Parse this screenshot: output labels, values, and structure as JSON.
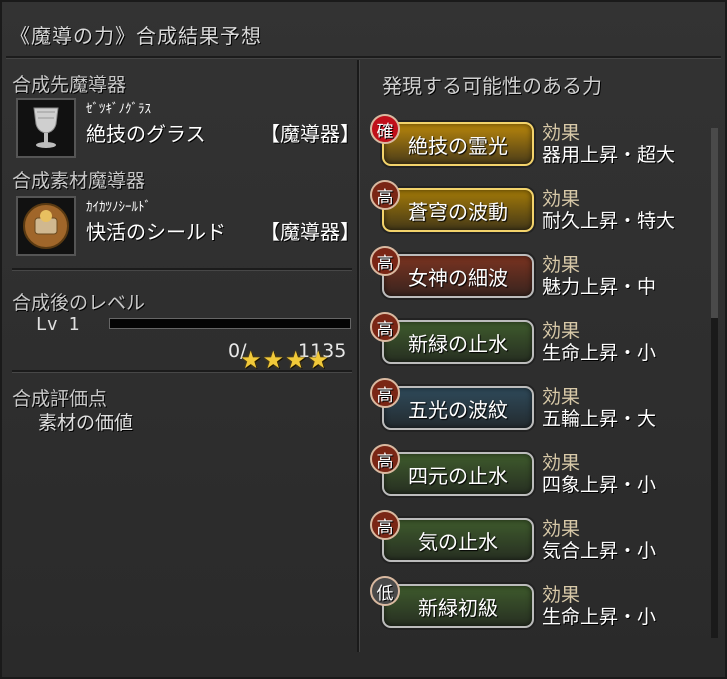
{
  "window": {
    "title": "《魔導の力》合成結果予想"
  },
  "left": {
    "target_label": "合成先魔導器",
    "target_item": {
      "kana": "ｾﾞﾂｷﾞﾉｸﾞﾗｽ",
      "name": "絶技のグラス",
      "tag": "【魔導器】",
      "icon": "goblet-icon"
    },
    "material_label": "合成素材魔導器",
    "material_item": {
      "kana": "ｶｲｶﾂﾉｼｰﾙﾄﾞ",
      "name": "快活のシールド",
      "tag": "【魔導器】",
      "icon": "shield-icon"
    },
    "level_label": "合成後のレベル",
    "level_text": "Lv  1",
    "exp_current": "0/",
    "exp_max": "1135",
    "exp_progress": 0,
    "eval_label": "合成評価点",
    "material_value_label": "素材の価値",
    "stars": "★★★★",
    "star_count": 4
  },
  "right": {
    "title": "発現する可能性のある力",
    "powers": [
      {
        "rank": "確",
        "rank_color": "#c0101a",
        "name": "絶技の霊光",
        "bg": "#b8860b",
        "effect_label": "効果",
        "effect": "器用上昇・超大"
      },
      {
        "rank": "高",
        "rank_color": "#7a2615",
        "name": "蒼穹の波動",
        "bg": "#a37a08",
        "effect_label": "効果",
        "effect": "耐久上昇・特大"
      },
      {
        "rank": "高",
        "rank_color": "#7a2615",
        "name": "女神の細波",
        "bg": "#7a3320",
        "effect_label": "効果",
        "effect": "魅力上昇・中"
      },
      {
        "rank": "高",
        "rank_color": "#7a2615",
        "name": "新緑の止水",
        "bg": "#3e5a2c",
        "effect_label": "効果",
        "effect": "生命上昇・小"
      },
      {
        "rank": "高",
        "rank_color": "#7a2615",
        "name": "五光の波紋",
        "bg": "#2f4a5a",
        "effect_label": "効果",
        "effect": "五輪上昇・大"
      },
      {
        "rank": "高",
        "rank_color": "#7a2615",
        "name": "四元の止水",
        "bg": "#3e5a2c",
        "effect_label": "効果",
        "effect": "四象上昇・小"
      },
      {
        "rank": "高",
        "rank_color": "#7a2615",
        "name": "気の止水",
        "bg": "#3e5a2c",
        "effect_label": "効果",
        "effect": "気合上昇・小"
      },
      {
        "rank": "低",
        "rank_color": "#4a4a4a",
        "name": "新緑初級",
        "bg": "#3e5a2c",
        "effect_label": "効果",
        "effect": "生命上昇・小"
      }
    ]
  }
}
